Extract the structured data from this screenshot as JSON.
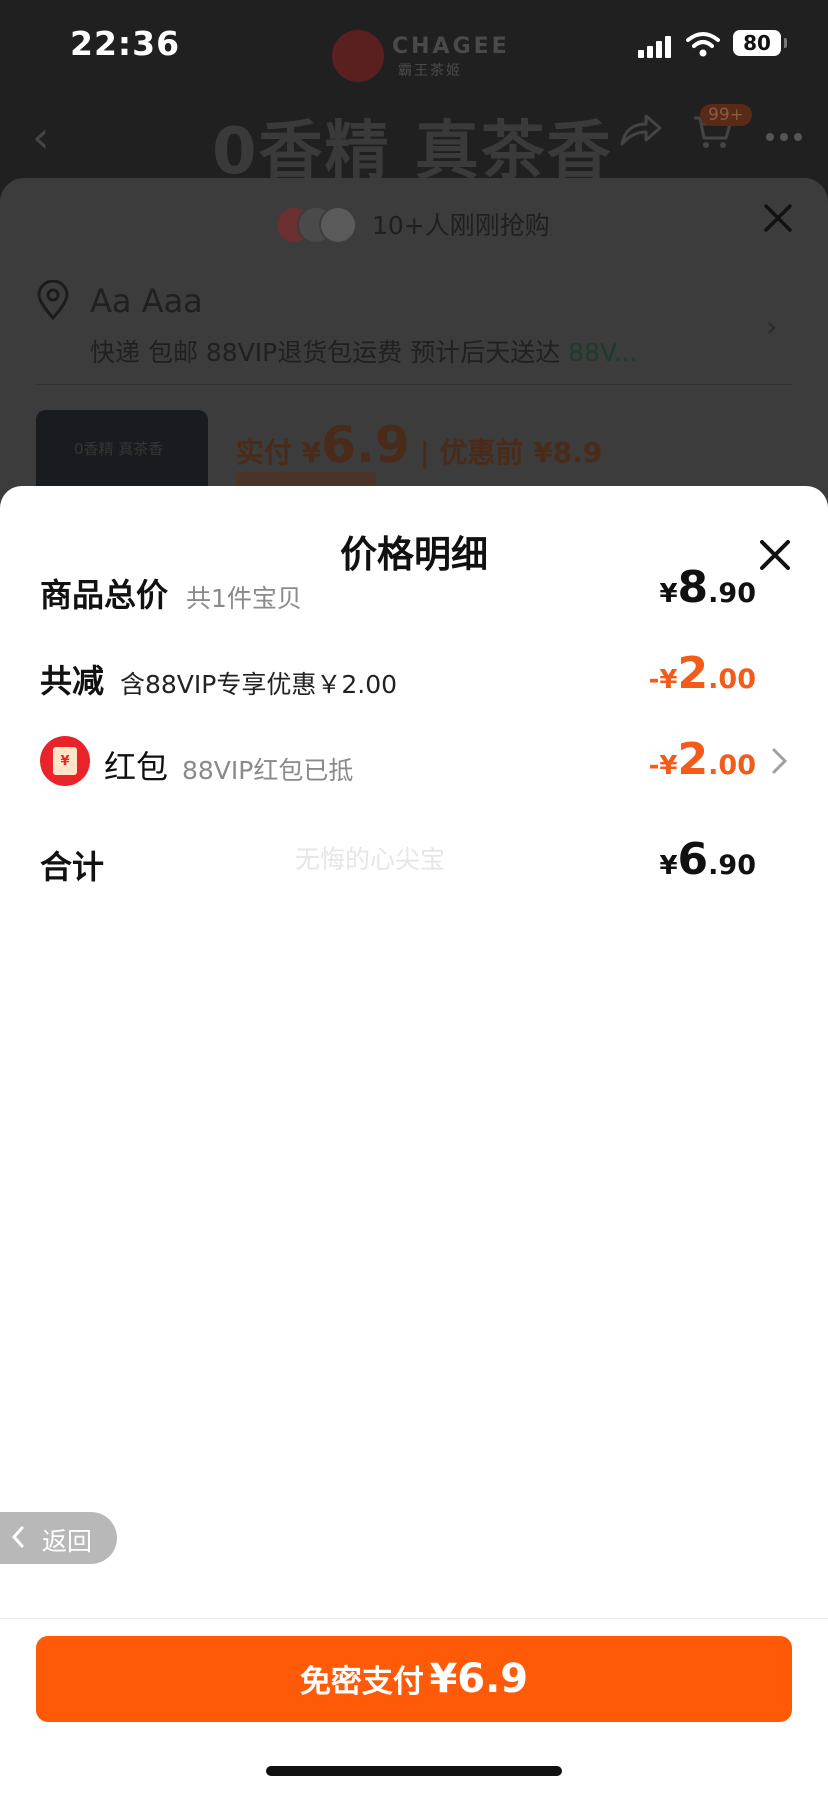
{
  "status_bar": {
    "time": "22:36",
    "battery": "80"
  },
  "brand": {
    "name": "CHAGEE",
    "subtitle": "霸王茶姬",
    "logo_icon": "chagee-logo-icon"
  },
  "product_header": {
    "title": "0香精 真茶香",
    "cart_badge": "99+"
  },
  "order_sheet": {
    "recent_buyers": "10+人刚刚抢购",
    "address_name": "Aa Aaa",
    "delivery_info": "快递 包邮 88VIP退货包运费 预计后天送达",
    "delivery_vip": "88V...",
    "thumbnail_text": "0香精 真茶香",
    "price_label": "实付 ¥",
    "price_value": "6.9",
    "price_before": "| 优惠前 ¥8.9"
  },
  "price_detail": {
    "title": "价格明细",
    "rows": [
      {
        "label": "商品总价",
        "sub": "共1件宝贝",
        "symbol": "¥",
        "integer": "8",
        "decimal": ".90"
      },
      {
        "label": "共减",
        "sub": "含88VIP专享优惠￥2.00",
        "symbol": "-¥",
        "integer": "2",
        "decimal": ".00"
      },
      {
        "label": "红包",
        "sub": "88VIP红包已抵",
        "symbol": "-¥",
        "integer": "2",
        "decimal": ".00",
        "icon_text": "¥"
      },
      {
        "label": "合计",
        "symbol": "¥",
        "integer": "6",
        "decimal": ".90"
      }
    ],
    "watermark": "无悔的心尖宝"
  },
  "back_button": {
    "label": "返回"
  },
  "pay_button": {
    "label": "免密支付",
    "amount": "¥6.9"
  },
  "colors": {
    "accent_orange": "#ff5a07",
    "discount_orange": "#f25b1a",
    "red_packet": "#e9232a"
  }
}
